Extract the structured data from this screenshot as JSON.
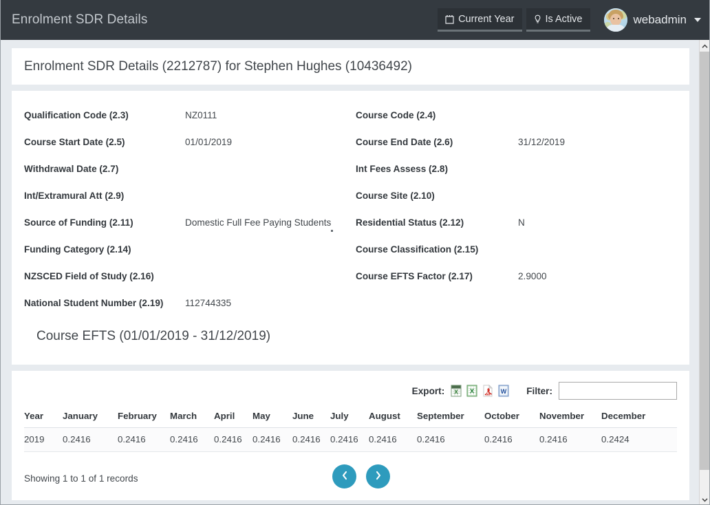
{
  "navbar": {
    "brand_title": "Enrolment SDR Details",
    "pills": [
      {
        "label": "Current Year",
        "icon": "calendar-icon"
      },
      {
        "label": "Is Active",
        "icon": "lightbulb-icon"
      }
    ],
    "user": {
      "name": "webadmin",
      "avatar": "user-avatar",
      "caret": "chevron-down-icon"
    },
    "colors": {
      "background": "#343a40",
      "pill_background": "#2c3136",
      "pill_underline": "#6b7378"
    }
  },
  "page": {
    "background_color": "#e7ebef",
    "heading": "Enrolment SDR Details (2212787) for Stephen Hughes (10436492)",
    "efts_heading": "Course EFTS (01/01/2019 - 31/12/2019)"
  },
  "details": {
    "rows": [
      {
        "label_left": "Qualification Code (2.3)",
        "value_left": "NZ0111",
        "label_right": "Course Code (2.4)",
        "value_right": ""
      },
      {
        "label_left": "Course Start Date (2.5)",
        "value_left": "01/01/2019",
        "label_right": "Course End Date (2.6)",
        "value_right": "31/12/2019"
      },
      {
        "label_left": "Withdrawal Date (2.7)",
        "value_left": "",
        "label_right": "Int Fees Assess (2.8)",
        "value_right": ""
      },
      {
        "label_left": "Int/Extramural Att (2.9)",
        "value_left": "",
        "label_right": "Course Site (2.10)",
        "value_right": ""
      },
      {
        "label_left": "Source of Funding (2.11)",
        "value_left": "Domestic Full Fee Paying Students",
        "label_right": "Residential Status (2.12)",
        "value_right": "N"
      },
      {
        "label_left": "Funding Category (2.14)",
        "value_left": "",
        "label_right": "Course Classification (2.15)",
        "value_right": ""
      },
      {
        "label_left": "NZSCED Field of Study (2.16)",
        "value_left": "",
        "label_right": "Course EFTS Factor (2.17)",
        "value_right": "2.9000"
      },
      {
        "label_left": "National Student Number (2.19)",
        "value_left": "112744335",
        "label_right": "",
        "value_right": ""
      }
    ]
  },
  "table_toolbar": {
    "export_label": "Export:",
    "export_icons": [
      {
        "name": "export-xml-icon",
        "title": "XML"
      },
      {
        "name": "export-excel-icon",
        "title": "Excel"
      },
      {
        "name": "export-pdf-icon",
        "title": "PDF"
      },
      {
        "name": "export-word-icon",
        "title": "Word"
      }
    ],
    "filter_label": "Filter:",
    "filter_value": "",
    "filter_placeholder": ""
  },
  "efts_table": {
    "columns": [
      "Year",
      "January",
      "February",
      "March",
      "April",
      "May",
      "June",
      "July",
      "August",
      "September",
      "October",
      "November",
      "December"
    ],
    "rows": [
      [
        "2019",
        "0.2416",
        "0.2416",
        "0.2416",
        "0.2416",
        "0.2416",
        "0.2416",
        "0.2416",
        "0.2416",
        "0.2416",
        "0.2416",
        "0.2416",
        "0.2424"
      ]
    ]
  },
  "table_footer": {
    "records_info": "Showing 1 to 1 of 1 records",
    "prev_label": "Previous page",
    "next_label": "Next page",
    "pager_color": "#2e9bbd"
  },
  "scrollbar": {
    "up_icon": "chevron-up-icon",
    "down_icon": "chevron-down-icon"
  }
}
